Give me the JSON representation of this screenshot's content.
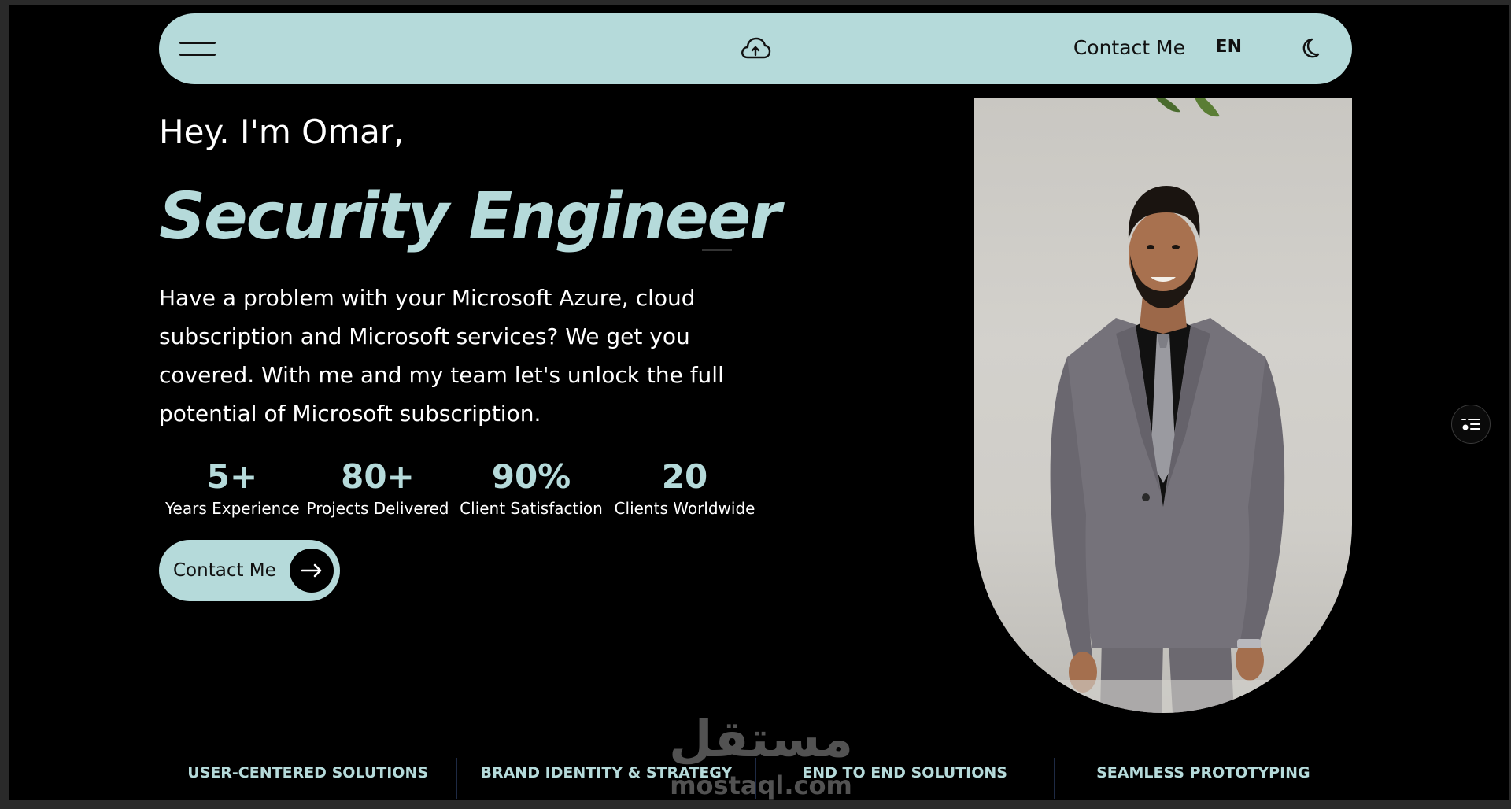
{
  "nav": {
    "contact_label": "Contact Me",
    "language": "EN"
  },
  "hero": {
    "greeting": "Hey. I'm Omar,",
    "role": "Security Engineer",
    "description": "Have a problem with your Microsoft Azure, cloud subscription and Microsoft services? We get you covered. With me and my team let's unlock the full potential of Microsoft subscription.",
    "cta_label": "Contact Me"
  },
  "stats": [
    {
      "value": "5+",
      "label": "Years Experience"
    },
    {
      "value": "80+",
      "label": "Projects Delivered"
    },
    {
      "value": "90%",
      "label": "Client Satisfaction"
    },
    {
      "value": "20",
      "label": "Clients Worldwide"
    }
  ],
  "services": [
    "USER-CENTERED SOLUTIONS",
    "BRAND IDENTITY & STRATEGY",
    "END TO END SOLUTIONS",
    "SEAMLESS PROTOTYPING"
  ],
  "watermark": {
    "arabic": "مستقل",
    "latin": "mostaql.com"
  },
  "colors": {
    "accent": "#b5dada",
    "background": "#000000",
    "text": "#ffffff"
  },
  "icons": {
    "menu": "hamburger-icon",
    "logo": "cloud-upload-icon",
    "theme": "moon-icon",
    "cta": "arrow-right-icon",
    "side": "list-settings-icon"
  }
}
